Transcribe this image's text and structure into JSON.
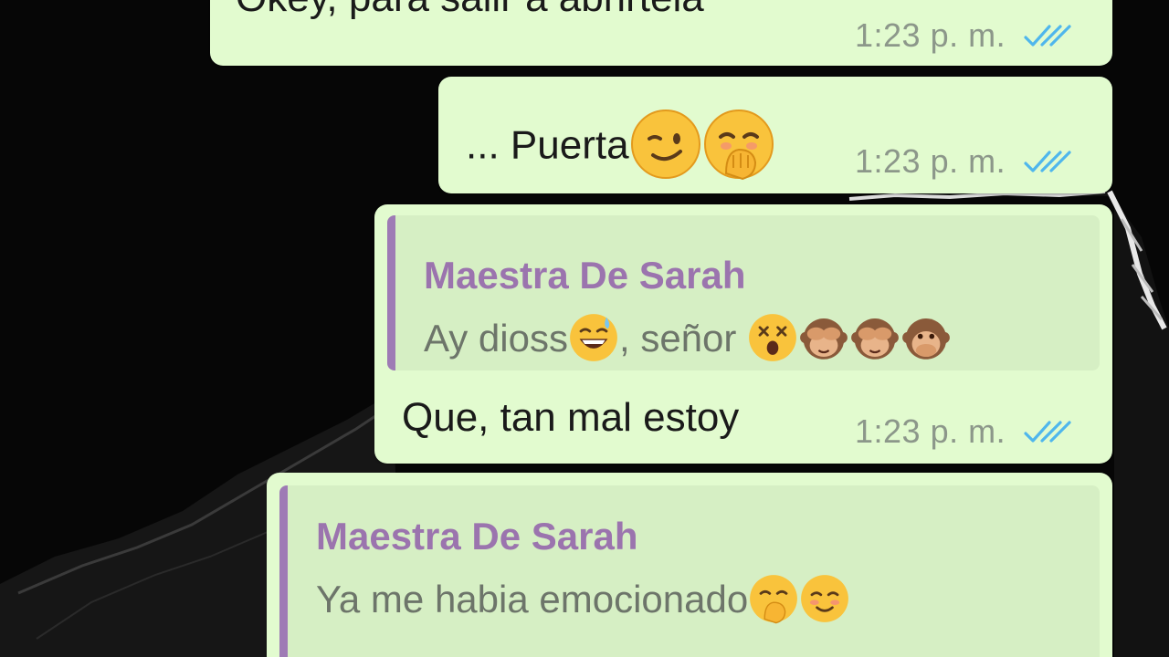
{
  "chat": {
    "messages": [
      {
        "text": "Okey, para salir a abrirtela",
        "time": "1:23 p. m.",
        "status": "read-double-check-icon"
      },
      {
        "text": "... Puerta",
        "emojis": [
          "winking-face-emoji",
          "face-with-hand-over-mouth-emoji"
        ],
        "time": "1:23 p. m.",
        "status": "read-double-check-icon"
      },
      {
        "quote": {
          "author": "Maestra De Sarah",
          "text_before": "Ay dioss",
          "text_after": ", señor",
          "emojis": [
            "grinning-sweat-emoji",
            "dizzy-face-emoji",
            "see-no-evil-monkey-emoji",
            "see-no-evil-monkey-emoji",
            "speak-no-evil-monkey-emoji"
          ]
        },
        "text": "Que, tan mal estoy",
        "time": "1:23 p. m.",
        "status": "read-double-check-icon"
      },
      {
        "quote": {
          "author": "Maestra De Sarah",
          "text_before": "Ya me habia emocionado",
          "emojis": [
            "face-with-hand-over-mouth-emoji",
            "smiling-face-emoji"
          ]
        }
      }
    ]
  },
  "colors": {
    "outgoing_bubble": "#e2fbcf",
    "quote_background": "#d6efc4",
    "quote_accent": "#9e7bb5",
    "read_ticks": "#4fb6ec",
    "wallpaper": "#060606"
  }
}
